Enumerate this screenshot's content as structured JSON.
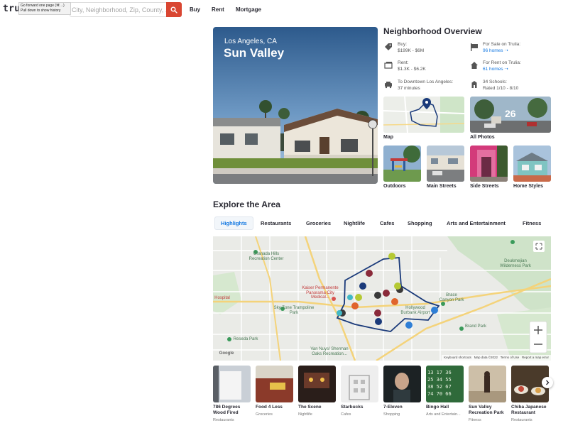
{
  "header": {
    "logo": "trul",
    "tooltip_line1": "Go forward one page (⌘→)",
    "tooltip_line2": "Pull down to show history",
    "search_placeholder": "City, Neighborhood, Zip, County, ...",
    "nav": [
      "Buy",
      "Rent",
      "Mortgage"
    ]
  },
  "hero": {
    "city": "Los Angeles, CA",
    "name": "Sun Valley"
  },
  "overview": {
    "title": "Neighborhood Overview",
    "buy_label": "Buy:",
    "buy_value": "$199K - $6M",
    "rent_label": "Rent:",
    "rent_value": "$1.3K - $6.2K",
    "commute_label": "To Downtown Los Angeles:",
    "commute_value": "37 minutes",
    "for_sale_label": "For Sale on Trulia:",
    "for_sale_value": "96 homes",
    "for_rent_label": "For Rent on Trulia:",
    "for_rent_value": "61 homes",
    "schools_label": "34 Schools:",
    "schools_value": "Rated 1/10 - 8/10",
    "map_label": "Map",
    "photos_label": "All Photos",
    "photos_count": "26",
    "categories": [
      "Outdoors",
      "Main Streets",
      "Side Streets",
      "Home Styles"
    ]
  },
  "explore": {
    "title": "Explore the Area",
    "tabs": [
      "Highlights",
      "Restaurants",
      "Groceries",
      "Nightlife",
      "Cafes",
      "Shopping",
      "Arts and Entertainment",
      "Fitness"
    ],
    "map": {
      "labels": {
        "granada": "Granada Hills Recreation Center",
        "kaiser": "Kaiser Permanente Panorama City Medical...",
        "skyzone": "Sky Zone Trampoline Park",
        "hollywood": "Hollywood Burbank Airport",
        "brace": "Brace Canyon Park",
        "deukmejian": "Deukmejian Wilderness Park",
        "reseda": "Reseda Park",
        "vannuys": "Van Nuys/ Sherman Oaks Recreation...",
        "brand": "Brand Park",
        "hospital": "Hospital",
        "google": "Google"
      },
      "footer": [
        "Keyboard shortcuts",
        "Map data ©2022",
        "Terms of Use",
        "Report a map error"
      ]
    },
    "places": [
      {
        "name": "786 Degrees Wood Fired",
        "category": "Restaurants"
      },
      {
        "name": "Food 4 Less",
        "category": "Groceries"
      },
      {
        "name": "The Scene",
        "category": "Nightlife"
      },
      {
        "name": "Starbucks",
        "category": "Cafes"
      },
      {
        "name": "7-Eleven",
        "category": "Shopping"
      },
      {
        "name": "Bingo Hall",
        "category": "Arts and Entertain..."
      },
      {
        "name": "Sun Valley Recreation Park",
        "category": "Fitness"
      },
      {
        "name": "Chiba Japanese Restaurant",
        "category": "Restaurants"
      }
    ]
  }
}
